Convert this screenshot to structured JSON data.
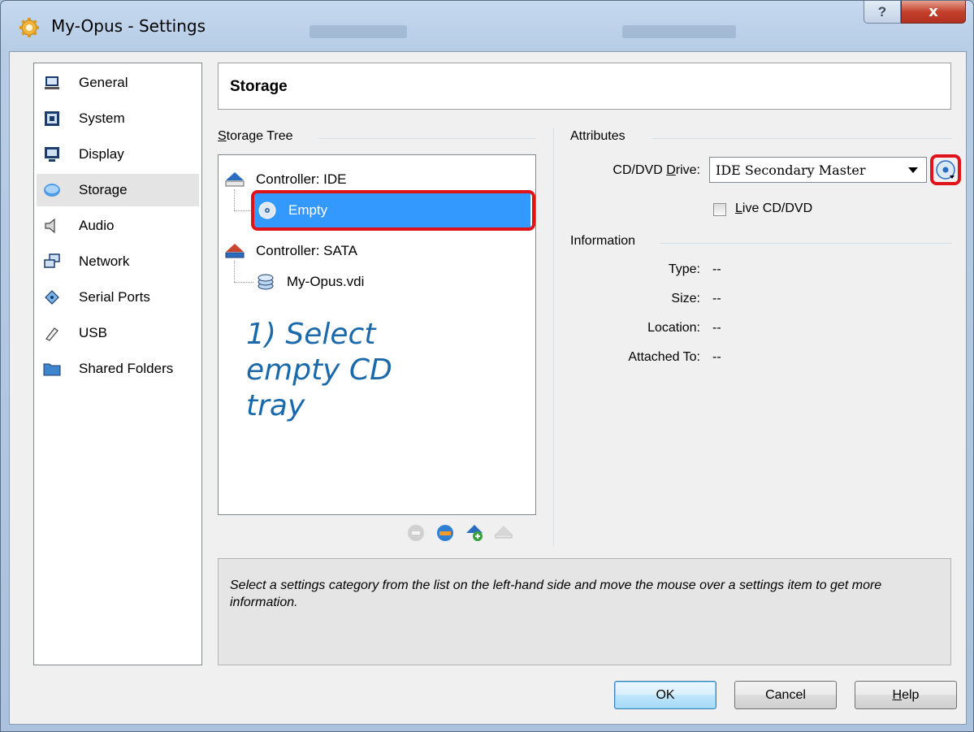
{
  "window": {
    "title": "My-Opus - Settings",
    "help_glyph": "?",
    "close_glyph": "x"
  },
  "sidebar": {
    "items": [
      {
        "label": "General",
        "icon": "monitor-icon"
      },
      {
        "label": "System",
        "icon": "chip-icon"
      },
      {
        "label": "Display",
        "icon": "display-icon"
      },
      {
        "label": "Storage",
        "icon": "disk-icon",
        "selected": true
      },
      {
        "label": "Audio",
        "icon": "speaker-icon"
      },
      {
        "label": "Network",
        "icon": "network-icon"
      },
      {
        "label": "Serial Ports",
        "icon": "serial-port-icon"
      },
      {
        "label": "USB",
        "icon": "usb-icon"
      },
      {
        "label": "Shared Folders",
        "icon": "folder-icon"
      }
    ]
  },
  "header": {
    "title": "Storage"
  },
  "storage_tree": {
    "label_prefix": "S",
    "label_rest": "torage Tree",
    "nodes": [
      {
        "label": "Controller: IDE",
        "type": "controller"
      },
      {
        "label": "Empty",
        "type": "cd",
        "selected": true
      },
      {
        "label": "Controller: SATA",
        "type": "controller"
      },
      {
        "label": "My-Opus.vdi",
        "type": "hdd"
      }
    ]
  },
  "annotation": {
    "text": "1) Select empty CD tray"
  },
  "attributes": {
    "group_label": "Attributes",
    "cd_drive_label_a": "CD/DVD ",
    "cd_drive_label_ul": "D",
    "cd_drive_label_b": "rive:",
    "cd_drive_value": "IDE Secondary Master",
    "live_cd_ul": "L",
    "live_cd_rest": "ive CD/DVD",
    "live_cd_checked": false
  },
  "information": {
    "group_label": "Information",
    "rows": [
      {
        "label": "Type:",
        "value": "--"
      },
      {
        "label": "Size:",
        "value": "--"
      },
      {
        "label": "Location:",
        "value": "--"
      },
      {
        "label": "Attached To:",
        "value": "--"
      }
    ]
  },
  "description": {
    "text": "Select a settings category from the list on the left-hand side and move the mouse over a settings item to get more information."
  },
  "buttons": {
    "ok": "OK",
    "cancel": "Cancel",
    "help_ul": "H",
    "help_rest": "elp"
  },
  "colors": {
    "selection": "#3399ff",
    "highlight_box": "#e0121a",
    "annotation": "#1a6aab"
  }
}
